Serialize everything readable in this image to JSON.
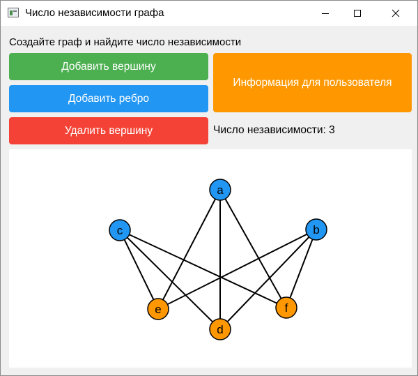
{
  "window": {
    "title": "Число независимости графа"
  },
  "main": {
    "heading": "Создайте граф и найдите число независимости",
    "add_vertex_label": "Добавить вершину",
    "add_edge_label": "Добавить ребро",
    "delete_vertex_label": "Удалить вершину",
    "info_label": "Информация для пользователя",
    "independence_text": "Число независимости: 3"
  },
  "colors": {
    "add_vertex": "#4caf50",
    "add_edge": "#2196f3",
    "delete_vertex": "#f44336",
    "info": "#ff9800",
    "vertex_default": "#2196f3",
    "vertex_independent": "#ff9800"
  },
  "graph": {
    "vertices": [
      {
        "id": "a",
        "label": "a",
        "in_independent_set": false
      },
      {
        "id": "b",
        "label": "b",
        "in_independent_set": false
      },
      {
        "id": "c",
        "label": "c",
        "in_independent_set": false
      },
      {
        "id": "d",
        "label": "d",
        "in_independent_set": true
      },
      {
        "id": "e",
        "label": "e",
        "in_independent_set": true
      },
      {
        "id": "f",
        "label": "f",
        "in_independent_set": true
      }
    ],
    "edges": [
      [
        "a",
        "d"
      ],
      [
        "a",
        "e"
      ],
      [
        "a",
        "f"
      ],
      [
        "b",
        "d"
      ],
      [
        "b",
        "e"
      ],
      [
        "b",
        "f"
      ],
      [
        "c",
        "d"
      ],
      [
        "c",
        "e"
      ],
      [
        "c",
        "f"
      ]
    ]
  }
}
